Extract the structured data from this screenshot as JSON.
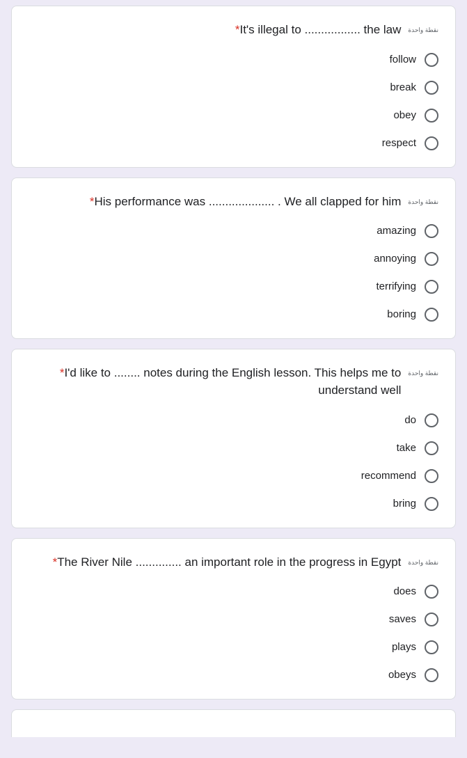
{
  "form": {
    "points_label": "نقطة واحدة",
    "required_marker": "*",
    "accent_required_color": "#d93025",
    "background_color": "#edeaf6",
    "card_color": "#ffffff",
    "questions": [
      {
        "text": "It's illegal to ................. the law",
        "points": "نقطة واحدة",
        "required": true,
        "options": [
          "follow",
          "break",
          "obey",
          "respect"
        ]
      },
      {
        "text": "His performance was .................... . We all clapped for him",
        "points": "نقطة واحدة",
        "required": true,
        "options": [
          "amazing",
          "annoying",
          "terrifying",
          "boring"
        ]
      },
      {
        "text": "I'd like to ........ notes during the English lesson. This helps me to understand well",
        "points": "نقطة واحدة",
        "required": true,
        "options": [
          "do",
          "take",
          "recommend",
          "bring"
        ]
      },
      {
        "text": "The River Nile .............. an important role in the progress in Egypt",
        "points": "نقطة واحدة",
        "required": true,
        "options": [
          "does",
          "saves",
          "plays",
          "obeys"
        ]
      }
    ]
  }
}
